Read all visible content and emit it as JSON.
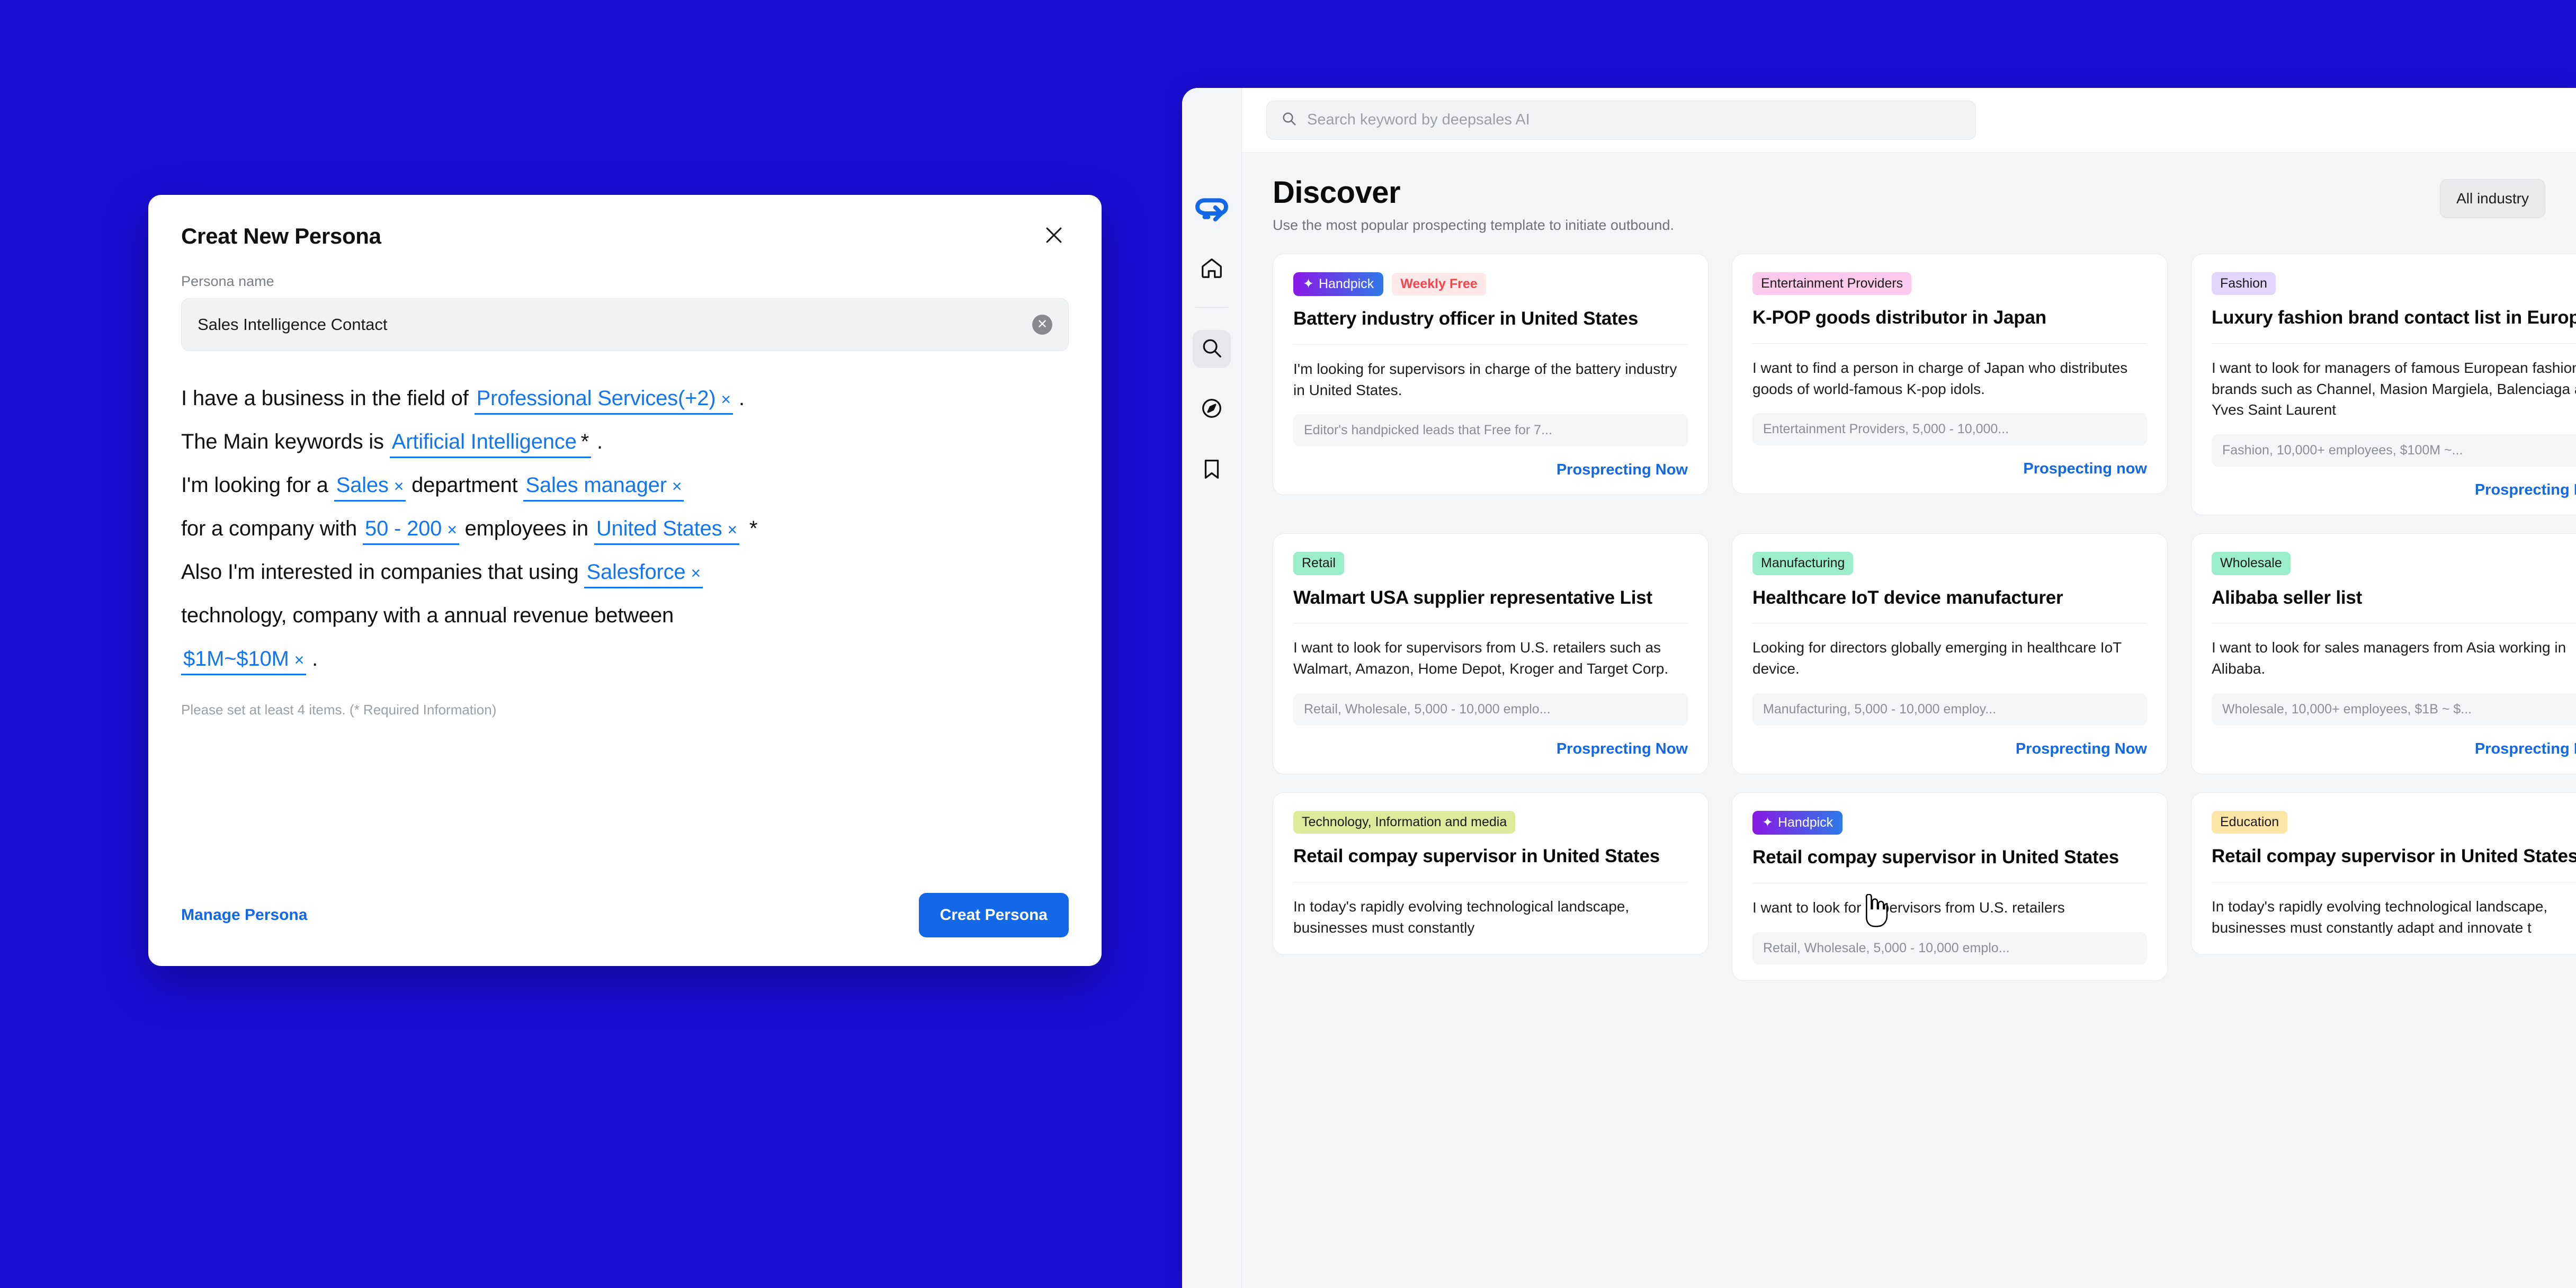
{
  "background_color": "#1A0ED6",
  "accent_color": "#1368E8",
  "modal": {
    "title": "Creat New Persona",
    "close_icon": "close-icon",
    "persona_name_label": "Persona name",
    "persona_name_value": "Sales Intelligence Contact",
    "persona_name_placeholder": "Persona name",
    "clear_icon": "clear-circle-icon",
    "sentence": {
      "l1_a": "I have a business in the field of",
      "l1_tok": "Professional Services(+2)",
      "l1_b": ".",
      "l2_a": "The Main keywords is",
      "l2_tok": "Artificial Intelligence",
      "l2_req": "*",
      "l2_b": ".",
      "l3_a": "I'm looking for a",
      "l3_tok1": "Sales",
      "l3_mid": "department",
      "l3_tok2": "Sales manager",
      "l4_a": "for a company with",
      "l4_tok1": "50 - 200",
      "l4_mid": "employees  in",
      "l4_tok2": "United States",
      "l4_req": "*",
      "l5_a": "Also I'm interested in companies that using",
      "l5_tok": "Salesforce",
      "l6_a": "technology,  company with a annual revenue between",
      "l7_tok": "$1M~$10M",
      "l7_b": ".",
      "remove_glyph": "×"
    },
    "hint": "Please set at least 4 items. (* Required Information)",
    "manage_label": "Manage Persona",
    "create_label": "Creat Persona"
  },
  "app": {
    "sidebar": {
      "logo_icon": "deepsales-cloud-logo",
      "items": [
        {
          "name": "home",
          "icon": "home-icon",
          "active": false
        },
        {
          "name": "search",
          "icon": "search-icon",
          "active": true
        },
        {
          "name": "discover",
          "icon": "compass-icon",
          "active": false
        },
        {
          "name": "saved",
          "icon": "bookmark-icon",
          "active": false
        }
      ]
    },
    "search": {
      "icon": "search-icon",
      "value": "",
      "placeholder": "Search keyword by deepsales AI"
    },
    "page_title": "Discover",
    "page_subtitle": "Use the most popular prospecting template to initiate outbound.",
    "industry_filter": "All industry",
    "cards": [
      {
        "badges": [
          {
            "label": "Handpick",
            "style": "handpick",
            "icon": "sparkle-icon"
          },
          {
            "label": "Weekly Free",
            "style": "weekly"
          }
        ],
        "title": "Battery industry officer in United States",
        "desc": "I'm looking for supervisors in charge of the battery industry in United States.",
        "meta": "Editor's handpicked leads that Free for 7...",
        "cta": "Prosprecting Now"
      },
      {
        "badges": [
          {
            "label": "Entertainment Providers",
            "style": "entertainment"
          }
        ],
        "title": "K-POP goods distributor in Japan",
        "desc": "I want to find a person in charge of Japan who distributes goods of world-famous K-pop idols.",
        "meta": "Entertainment Providers, 5,000 - 10,000...",
        "cta": "Prospecting now"
      },
      {
        "badges": [
          {
            "label": "Fashion",
            "style": "fashion"
          }
        ],
        "title": "Luxury fashion brand contact list in Europe",
        "desc": "I want to look for managers of famous European fashion brands such as Channel, Masion Margiela, Balenciaga and Yves Saint Laurent",
        "meta": "Fashion, 10,000+  employees, $100M ~...",
        "cta": "Prosprecting Now"
      },
      {
        "badges": [
          {
            "label": "Retail",
            "style": "retail"
          }
        ],
        "title": "Walmart USA supplier representative List",
        "desc": "I want to look for supervisors from U.S. retailers such as Walmart, Amazon, Home Depot, Kroger and Target Corp.",
        "meta": "Retail, Wholesale, 5,000 - 10,000 emplo...",
        "cta": "Prosprecting Now"
      },
      {
        "badges": [
          {
            "label": "Manufacturing",
            "style": "manufacturing"
          }
        ],
        "title": "Healthcare IoT device manufacturer",
        "desc": "Looking for directors globally emerging in healthcare IoT device.",
        "meta": "Manufacturing, 5,000 - 10,000 employ...",
        "cta": "Prosprecting Now"
      },
      {
        "badges": [
          {
            "label": "Wholesale",
            "style": "wholesale"
          }
        ],
        "title": "Alibaba seller list",
        "desc": "I want to look for sales managers from Asia working in Alibaba.",
        "meta": "Wholesale, 10,000+ employees, $1B ~ $...",
        "cta": "Prosprecting Now"
      },
      {
        "badges": [
          {
            "label": "Technology, Information and media",
            "style": "tech"
          }
        ],
        "title": "Retail compay supervisor in United States",
        "desc": "In today's rapidly evolving technological landscape, businesses must constantly",
        "meta": "",
        "cta": ""
      },
      {
        "badges": [
          {
            "label": "Handpick",
            "style": "handpick",
            "icon": "sparkle-icon"
          }
        ],
        "title": "Retail compay supervisor in United States",
        "desc": "I want to look for supervisors from U.S. retailers",
        "meta": "Retail, Wholesale, 5,000 - 10,000 emplo...",
        "cta": ""
      },
      {
        "badges": [
          {
            "label": "Education",
            "style": "education"
          }
        ],
        "title": "Retail compay supervisor in United States",
        "desc": "In today's rapidly evolving technological landscape, businesses must constantly adapt and innovate t",
        "meta": "",
        "cta": ""
      }
    ]
  }
}
